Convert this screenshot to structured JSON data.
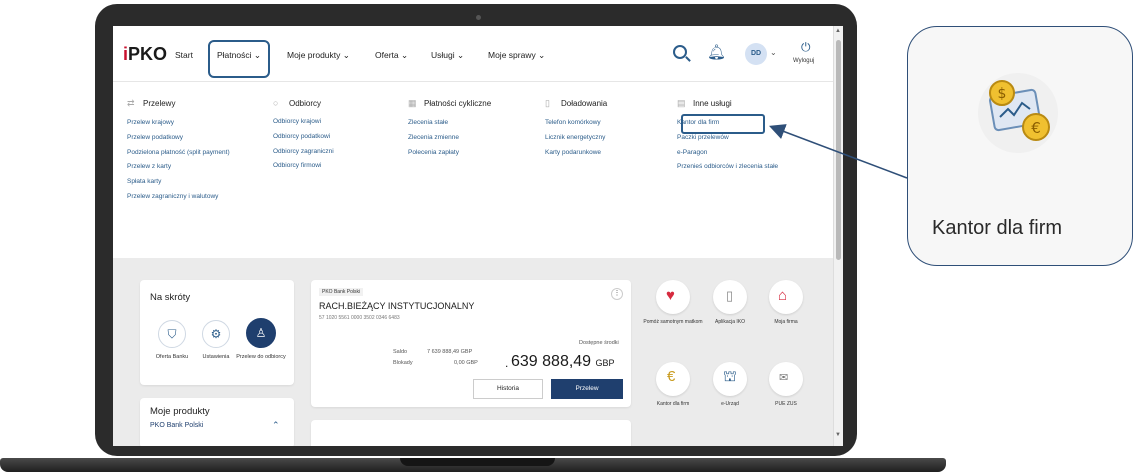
{
  "nav": {
    "logo": "PKO",
    "items": [
      {
        "label": "Start"
      },
      {
        "label": "Płatności ⌄"
      },
      {
        "label": "Moje produkty ⌄"
      },
      {
        "label": "Oferta ⌄"
      },
      {
        "label": "Usługi ⌄"
      },
      {
        "label": "Moje sprawy ⌄"
      }
    ],
    "avatar": "DD",
    "logout": "Wyloguj"
  },
  "menu": {
    "columns": [
      {
        "title": "Przelewy",
        "icon": "transfer-icon",
        "links": [
          "Przelew krajowy",
          "Przelew podatkowy",
          "Podzielona płatność (split payment)",
          "Przelew z karty",
          "Spłata karty",
          "Przelew zagraniczny i walutowy"
        ]
      },
      {
        "title": "Odbiorcy",
        "icon": "person-icon",
        "links": [
          "Odbiorcy krajowi",
          "Odbiorcy podatkowi",
          "Odbiorcy zagraniczni",
          "Odbiorcy firmowi"
        ]
      },
      {
        "title": "Płatności cykliczne",
        "icon": "calendar-icon",
        "links": [
          "Zlecenia stałe",
          "Zlecenia zmienne",
          "Polecenia zapłaty"
        ]
      },
      {
        "title": "Doładowania",
        "icon": "phone-icon",
        "links": [
          "Telefon komórkowy",
          "Licznik energetyczny",
          "Karty podarunkowe"
        ]
      },
      {
        "title": "Inne usługi",
        "icon": "services-icon",
        "links": [
          "Kantor dla firm",
          "Paczki przelewów",
          "e-Paragon",
          "Przenieś odbiorców i zlecenia stałe"
        ]
      }
    ]
  },
  "shortcuts": {
    "title": "Na skróty",
    "items": [
      {
        "label": "Oferta Banku",
        "icon": "bag-icon"
      },
      {
        "label": "Ustawienia",
        "icon": "gear-icon"
      },
      {
        "label": "Przelew do odbiorcy",
        "icon": "user-icon"
      }
    ]
  },
  "products": {
    "title": "Moje produkty",
    "bank": "PKO Bank Polski"
  },
  "account": {
    "bank": "PKO Bank Polski",
    "name": "RACH.BIEŻĄCY INSTYTUCJONALNY",
    "number": "57 1020 5561 0000 3502 0346 6483",
    "saldo_label": "Saldo",
    "saldo_value": "7 639 888,49 GBP",
    "blokady_label": "Blokady",
    "blokady_value": "0,00 GBP",
    "available_label": "Dostępne środki",
    "available_value": "639 888,49",
    "currency": "GBP",
    "history_btn": "Historia",
    "transfer_btn": "Przelew"
  },
  "services": [
    {
      "label": "Pomóż samotnym matkom",
      "icon": "heart-hands-icon"
    },
    {
      "label": "Aplikacja IKO",
      "icon": "mobile-app-icon"
    },
    {
      "label": "Moja firma",
      "icon": "company-icon"
    },
    {
      "label": "Kantor dla firm",
      "icon": "exchange-icon"
    },
    {
      "label": "e-Urząd",
      "icon": "government-icon"
    },
    {
      "label": "PUE ZUS",
      "icon": "zus-icon"
    }
  ],
  "callout": {
    "label": "Kantor dla firm"
  },
  "colors": {
    "accent": "#2b5c8a",
    "primary": "#1f3f6e",
    "brand_red": "#c8102e"
  }
}
